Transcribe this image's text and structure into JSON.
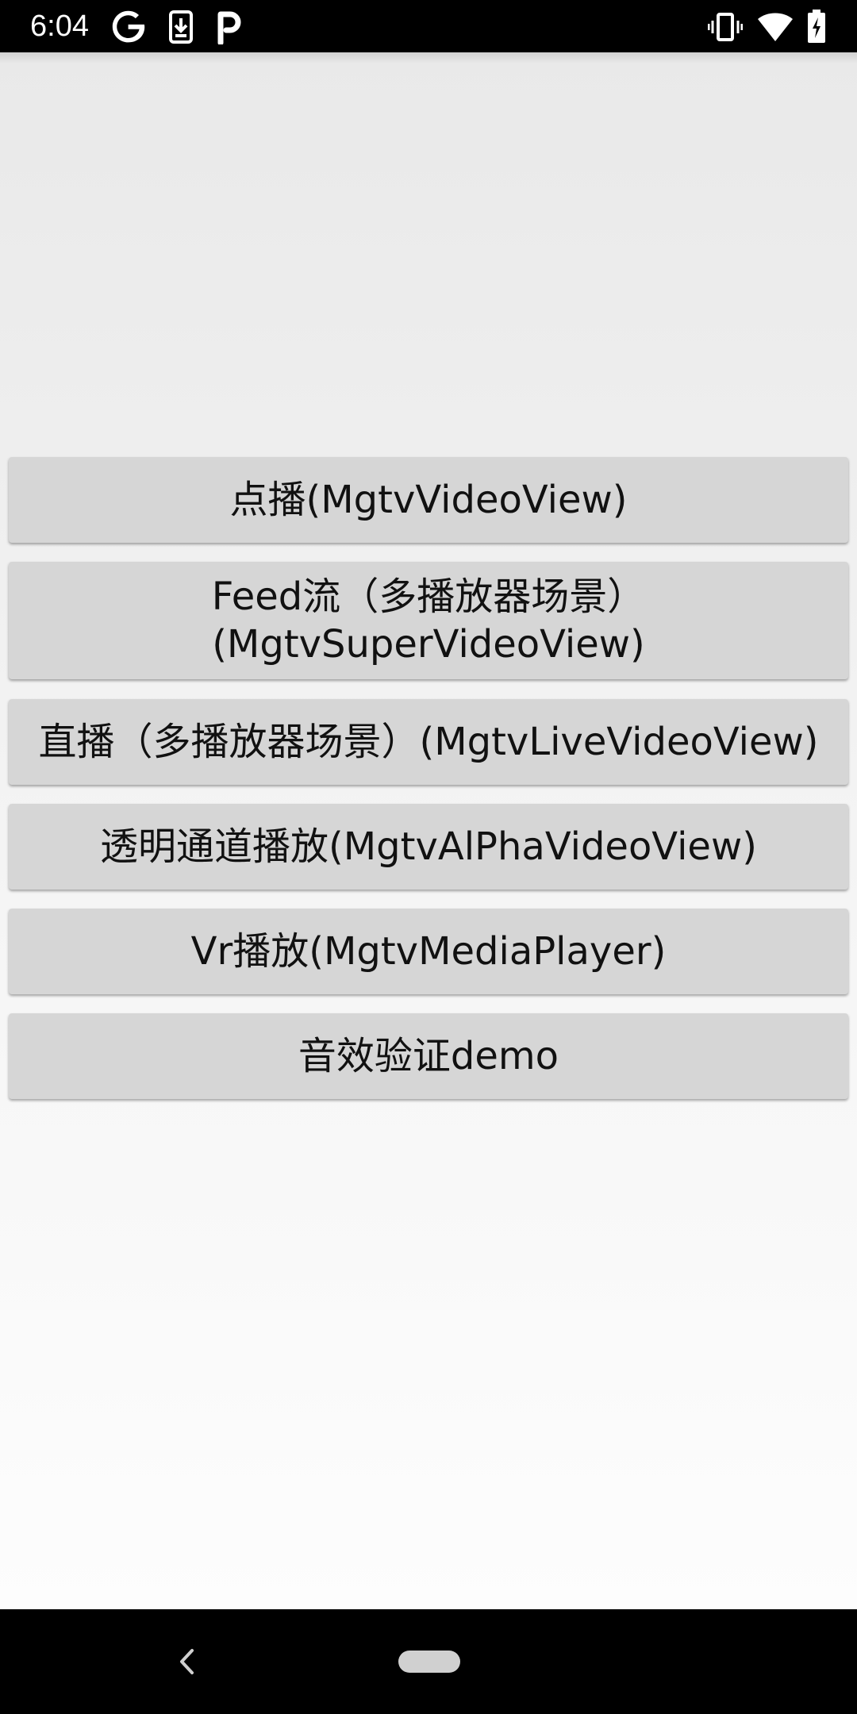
{
  "status_bar": {
    "time": "6:04",
    "left_icons": [
      "google-icon",
      "download-icon",
      "parking-icon"
    ],
    "right_icons": [
      "vibrate-icon",
      "wifi-icon",
      "battery-charging-icon"
    ]
  },
  "buttons": [
    {
      "label": "点播(MgtvVideoView)"
    },
    {
      "label": "Feed流（多播放器场景）\n(MgtvSuperVideoView)"
    },
    {
      "label": "直播（多播放器场景）(MgtvLiveVideoView)"
    },
    {
      "label": "透明通道播放(MgtvAlPhaVideoView)"
    },
    {
      "label": "Vr播放(MgtvMediaPlayer)"
    },
    {
      "label": "音效验证demo"
    }
  ],
  "nav_bar": {
    "icons": [
      "back-icon",
      "home-pill-icon"
    ]
  },
  "colors": {
    "button_bg": "#d6d6d6",
    "bar_bg": "#000000",
    "content_bg": "#eeeeee"
  }
}
